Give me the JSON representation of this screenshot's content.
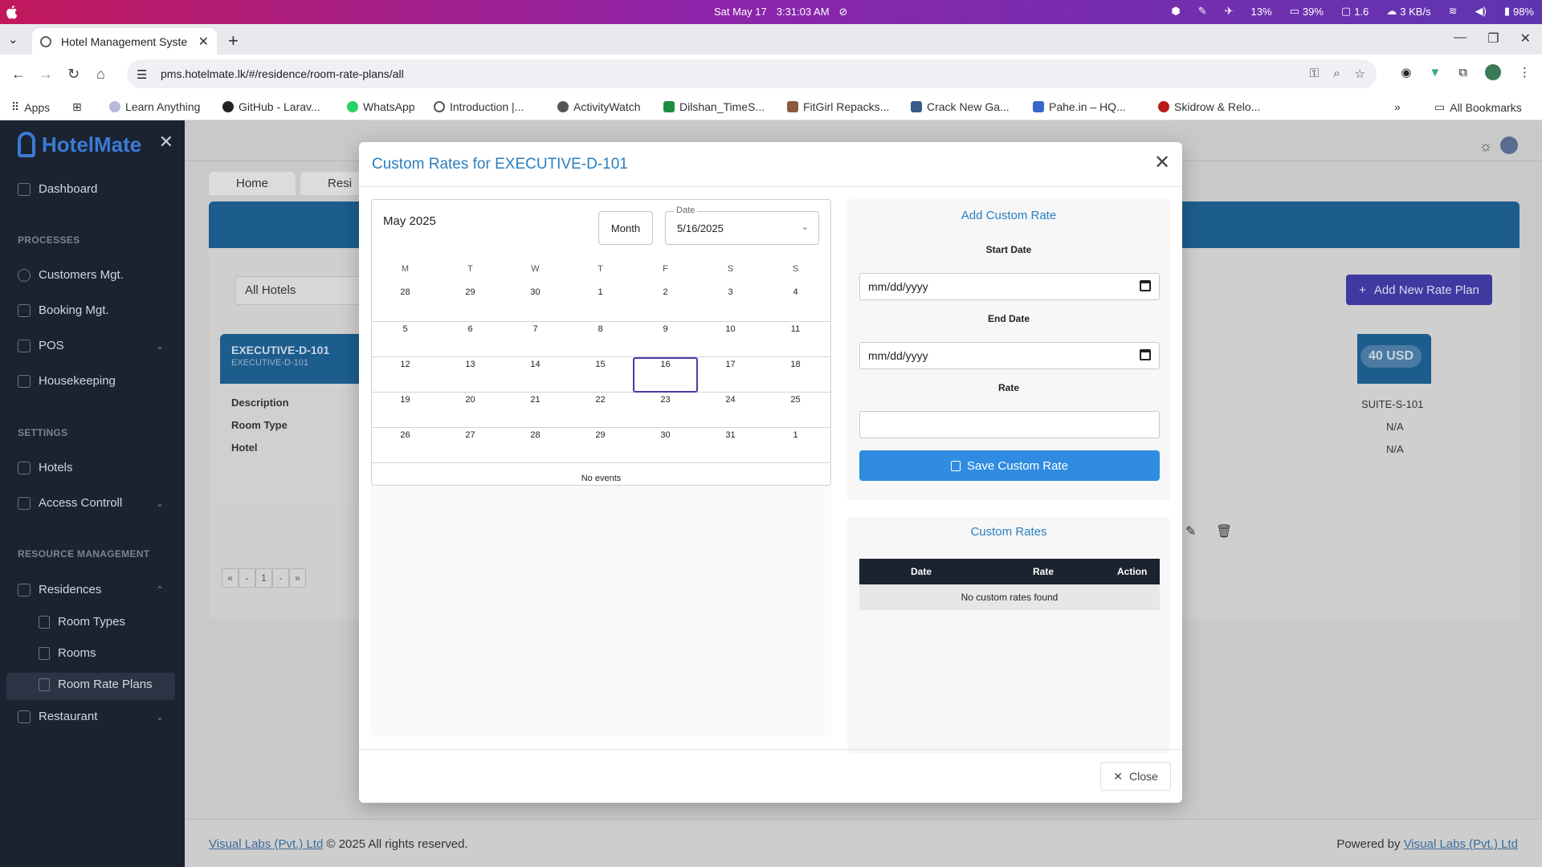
{
  "os": {
    "day": "Sat May 17",
    "time": "3:31:03 AM",
    "cpu": "13%",
    "mem": "39%",
    "load": "1.6",
    "net": "3 KB/s",
    "battery": "98%"
  },
  "browser": {
    "tab_title": "Hotel Management Syste",
    "url": "pms.hotelmate.lk/#/residence/room-rate-plans/all",
    "bookmarks": [
      "Apps",
      "Learn Anything",
      "GitHub - Larav...",
      "WhatsApp",
      "Introduction |...",
      "ActivityWatch",
      "Dilshan_TimeS...",
      "FitGirl Repacks...",
      "Crack New Ga...",
      "Pahe.in – HQ...",
      "Skidrow & Relo..."
    ],
    "all_bookmarks": "All Bookmarks",
    "more": "»"
  },
  "sidebar": {
    "logo": "HotelMate",
    "dashboard": "Dashboard",
    "sec_processes": "PROCESSES",
    "customers": "Customers Mgt.",
    "booking": "Booking Mgt.",
    "pos": "POS",
    "housekeeping": "Housekeeping",
    "sec_settings": "SETTINGS",
    "hotels": "Hotels",
    "access": "Access Controll",
    "sec_resource": "RESOURCE MANAGEMENT",
    "residences": "Residences",
    "room_types": "Room Types",
    "rooms": "Rooms",
    "room_rate_plans": "Room Rate Plans",
    "restaurant": "Restaurant"
  },
  "page": {
    "crumb_home": "Home",
    "crumb_resi": "Resi",
    "filter": "All Hotels",
    "add_plan": "Add New Rate Plan",
    "room_title": "EXECUTIVE-D-101",
    "room_sub": "EXECUTIVE-D-101",
    "lbl_description": "Description",
    "lbl_room_type": "Room Type",
    "lbl_hotel": "Hotel",
    "room2_usd": "40 USD",
    "room2_code": "SUITE-S-101",
    "room2_type": "N/A",
    "room2_hotel": "N/A",
    "pager": [
      "«",
      "-",
      "1",
      "-",
      "»"
    ]
  },
  "footer": {
    "company": "Visual Labs (Pvt.) Ltd",
    "copyright": "© 2025 All rights reserved.",
    "powered": "Powered by",
    "company2": "Visual Labs (Pvt.) Ltd"
  },
  "modal": {
    "title": "Custom Rates for EXECUTIVE-D-101",
    "calendar": {
      "month_label": "May 2025",
      "view": "Month",
      "date_label": "Date",
      "date_value": "5/16/2025",
      "weekdays": [
        "M",
        "T",
        "W",
        "T",
        "F",
        "S",
        "S"
      ],
      "weeks": [
        [
          "28",
          "29",
          "30",
          "1",
          "2",
          "3",
          "4"
        ],
        [
          "5",
          "6",
          "7",
          "8",
          "9",
          "10",
          "11"
        ],
        [
          "12",
          "13",
          "14",
          "15",
          "16",
          "17",
          "18"
        ],
        [
          "19",
          "20",
          "21",
          "22",
          "23",
          "24",
          "25"
        ],
        [
          "26",
          "27",
          "28",
          "29",
          "30",
          "31",
          "1"
        ]
      ],
      "no_events": "No events"
    },
    "form": {
      "heading": "Add Custom Rate",
      "start_label": "Start Date",
      "start_placeholder": "mm/dd/yyyy",
      "end_label": "End Date",
      "end_placeholder": "mm/dd/yyyy",
      "rate_label": "Rate",
      "rate_value": "",
      "save": "Save Custom Rate"
    },
    "list": {
      "heading": "Custom Rates",
      "col_date": "Date",
      "col_rate": "Rate",
      "col_action": "Action",
      "empty": "No custom rates found"
    },
    "close": "Close"
  }
}
